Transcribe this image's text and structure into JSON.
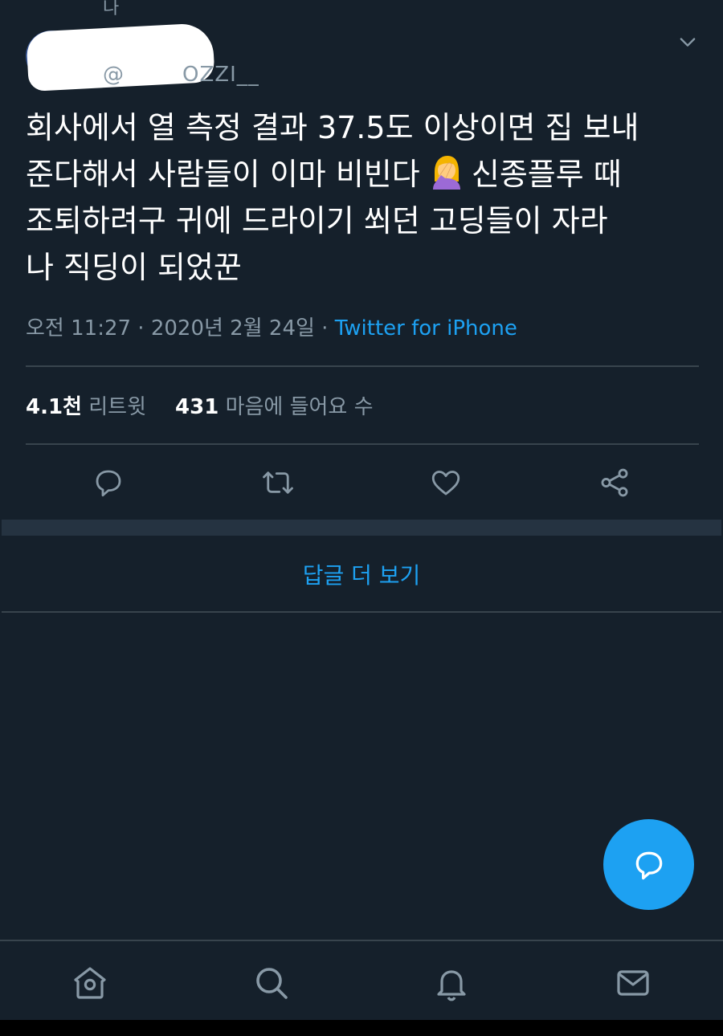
{
  "previous_fragment": "나",
  "author": {
    "handle": "@",
    "handle_suffix": "OZZI__"
  },
  "tweet": {
    "line1": "회사에서 열 측정 결과 37.5도 이상이면 집 보내",
    "line2_before_emoji": "준다해서 사람들이 이마 비빈다",
    "line2_after_emoji": " 신종플루 때",
    "line3": "조퇴하려구 귀에 드라이기 쐬던 고딩들이 자라",
    "line4": "나 직딩이 되었꾼",
    "emoji": "face-palm-emoji"
  },
  "meta": {
    "datetime": "오전 11:27 · 2020년 2월 24일",
    "separator": " · ",
    "source": "Twitter for iPhone"
  },
  "stats": {
    "retweets_count": "4.1천",
    "retweets_label": "리트윗",
    "likes_count": "431",
    "likes_label": "마음에 들어요 수"
  },
  "actions": {
    "reply_icon": "reply-icon",
    "retweet_icon": "retweet-icon",
    "like_icon": "heart-icon",
    "share_icon": "share-icon"
  },
  "more_replies_label": "답글 더 보기",
  "fab_icon": "compose-reply-icon",
  "nav": {
    "home_icon": "home-icon",
    "search_icon": "search-icon",
    "notifications_icon": "bell-icon",
    "messages_icon": "mail-icon"
  },
  "colors": {
    "background": "#15202b",
    "accent": "#1da1f2",
    "muted": "#8899a6",
    "divider": "#38444d"
  }
}
